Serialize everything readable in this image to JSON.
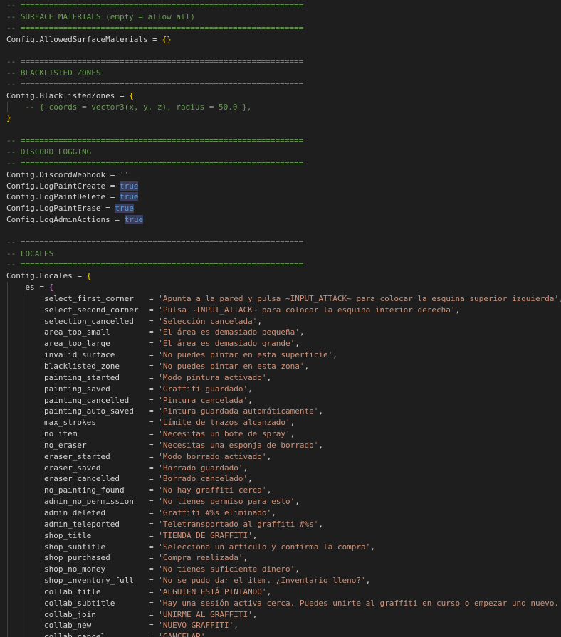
{
  "editor": {
    "sep": "-- ============================================================",
    "surface": {
      "header": "-- SURFACE MATERIALS (empty = allow all)",
      "code_name": "Config.AllowedSurfaceMaterials",
      "eq": " = ",
      "value": "{}"
    },
    "blacklist": {
      "header": "-- BLACKLISTED ZONES",
      "code_name": "Config.BlacklistedZones",
      "eq": " = ",
      "open": "{",
      "comment": "-- { coords = vector3(x, y, z), radius = 50.0 },",
      "close": "}"
    },
    "discord": {
      "header": "-- DISCORD LOGGING",
      "webhook_name": "Config.DiscordWebhook",
      "eq": " = ",
      "webhook_value": "''",
      "bools": [
        {
          "name": "Config.LogPaintCreate",
          "eq": " = ",
          "value": "true"
        },
        {
          "name": "Config.LogPaintDelete",
          "eq": " = ",
          "value": "true"
        },
        {
          "name": "Config.LogPaintErase",
          "eq": " = ",
          "value": "true"
        },
        {
          "name": "Config.LogAdminActions",
          "eq": " = ",
          "value": "true"
        }
      ]
    },
    "locales": {
      "header": "-- LOCALES",
      "code_name": "Config.Locales",
      "eq": " = ",
      "open": "{",
      "es_key": "es",
      "es_eq": " = ",
      "es_open": "{",
      "items": [
        {
          "key": "select_first_corner",
          "eq": "= ",
          "value": "'Apunta a la pared y pulsa ~INPUT_ATTACK~ para colocar la esquina superior izquierda'",
          "comma": ","
        },
        {
          "key": "select_second_corner",
          "eq": "= ",
          "value": "'Pulsa ~INPUT_ATTACK~ para colocar la esquina inferior derecha'",
          "comma": ","
        },
        {
          "key": "selection_cancelled",
          "eq": "= ",
          "value": "'Selección cancelada'",
          "comma": ","
        },
        {
          "key": "area_too_small",
          "eq": "= ",
          "value": "'El área es demasiado pequeña'",
          "comma": ","
        },
        {
          "key": "area_too_large",
          "eq": "= ",
          "value": "'El área es demasiado grande'",
          "comma": ","
        },
        {
          "key": "invalid_surface",
          "eq": "= ",
          "value": "'No puedes pintar en esta superficie'",
          "comma": ","
        },
        {
          "key": "blacklisted_zone",
          "eq": "= ",
          "value": "'No puedes pintar en esta zona'",
          "comma": ","
        },
        {
          "key": "painting_started",
          "eq": "= ",
          "value": "'Modo pintura activado'",
          "comma": ","
        },
        {
          "key": "painting_saved",
          "eq": "= ",
          "value": "'Graffiti guardado'",
          "comma": ","
        },
        {
          "key": "painting_cancelled",
          "eq": "= ",
          "value": "'Pintura cancelada'",
          "comma": ","
        },
        {
          "key": "painting_auto_saved",
          "eq": "= ",
          "value": "'Pintura guardada automáticamente'",
          "comma": ","
        },
        {
          "key": "max_strokes",
          "eq": "= ",
          "value": "'Límite de trazos alcanzado'",
          "comma": ","
        },
        {
          "key": "no_item",
          "eq": "= ",
          "value": "'Necesitas un bote de spray'",
          "comma": ","
        },
        {
          "key": "no_eraser",
          "eq": "= ",
          "value": "'Necesitas una esponja de borrado'",
          "comma": ","
        },
        {
          "key": "eraser_started",
          "eq": "= ",
          "value": "'Modo borrado activado'",
          "comma": ","
        },
        {
          "key": "eraser_saved",
          "eq": "= ",
          "value": "'Borrado guardado'",
          "comma": ","
        },
        {
          "key": "eraser_cancelled",
          "eq": "= ",
          "value": "'Borrado cancelado'",
          "comma": ","
        },
        {
          "key": "no_painting_found",
          "eq": "= ",
          "value": "'No hay graffiti cerca'",
          "comma": ","
        },
        {
          "key": "admin_no_permission",
          "eq": "= ",
          "value": "'No tienes permiso para esto'",
          "comma": ","
        },
        {
          "key": "admin_deleted",
          "eq": "= ",
          "value": "'Graffiti #%s eliminado'",
          "comma": ","
        },
        {
          "key": "admin_teleported",
          "eq": "= ",
          "value": "'Teletransportado al graffiti #%s'",
          "comma": ","
        },
        {
          "key": "shop_title",
          "eq": "= ",
          "value": "'TIENDA DE GRAFFITI'",
          "comma": ","
        },
        {
          "key": "shop_subtitle",
          "eq": "= ",
          "value": "'Selecciona un artículo y confirma la compra'",
          "comma": ","
        },
        {
          "key": "shop_purchased",
          "eq": "= ",
          "value": "'Compra realizada'",
          "comma": ","
        },
        {
          "key": "shop_no_money",
          "eq": "= ",
          "value": "'No tienes suficiente dinero'",
          "comma": ","
        },
        {
          "key": "shop_inventory_full",
          "eq": "= ",
          "value": "'No se pudo dar el item. ¿Inventario lleno?'",
          "comma": ","
        },
        {
          "key": "collab_title",
          "eq": "= ",
          "value": "'ALGUIEN ESTÁ PINTANDO'",
          "comma": ","
        },
        {
          "key": "collab_subtitle",
          "eq": "= ",
          "value": "'Hay una sesión activa cerca. Puedes unirte al graffiti en curso o empezar uno nuevo.'",
          "comma": ","
        },
        {
          "key": "collab_join",
          "eq": "= ",
          "value": "'UNIRME AL GRAFFITI'",
          "comma": ","
        },
        {
          "key": "collab_new",
          "eq": "= ",
          "value": "'NUEVO GRAFFITI'",
          "comma": ","
        },
        {
          "key": "collab_cancel",
          "eq": "= ",
          "value": "'CANCELAR'",
          "comma": ","
        }
      ]
    }
  }
}
